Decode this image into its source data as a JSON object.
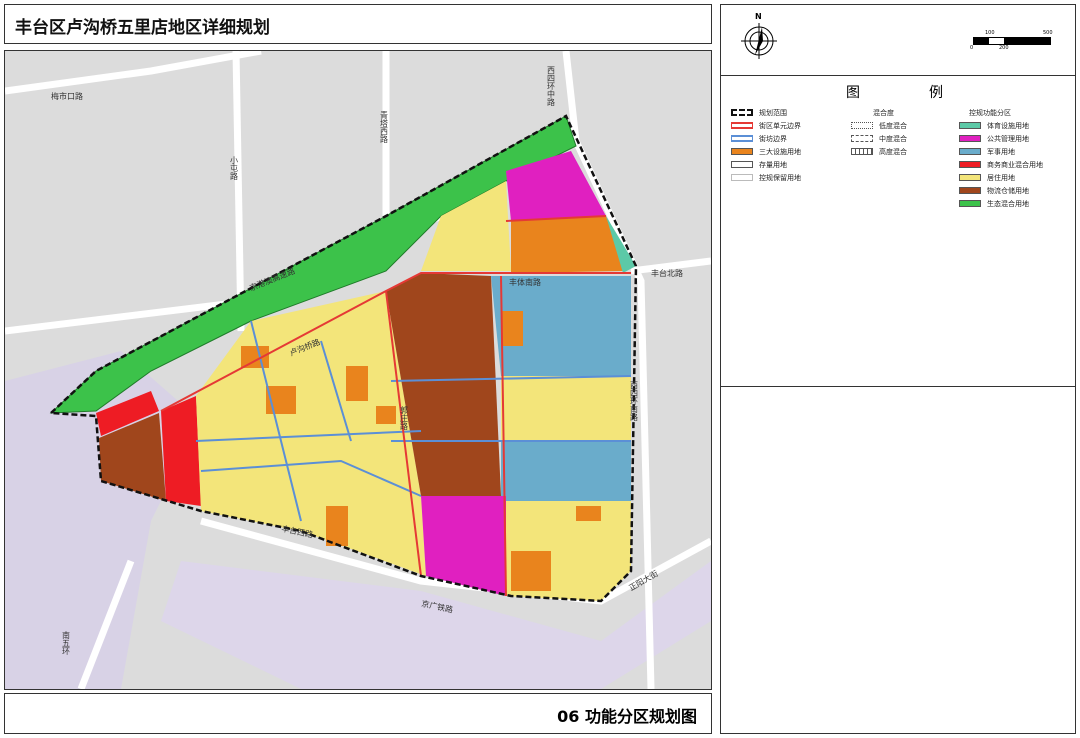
{
  "title": "丰台区卢沟桥五里店地区详细规划",
  "footer": "06 功能分区规划图",
  "compass": {
    "north": "N"
  },
  "scale": {
    "labels": [
      "0",
      "100",
      "200",
      "500"
    ]
  },
  "legend": {
    "heading_left": "图",
    "heading_right": "例",
    "col1": [
      {
        "label": "规划范围",
        "style": "boundary"
      },
      {
        "label": "街区单元边界",
        "color": "#e53935"
      },
      {
        "label": "街坊边界",
        "color": "#5b8fd6"
      },
      {
        "label": "三大设施用地",
        "color": "#e9841d"
      },
      {
        "label": "存量用地",
        "color": "#ffffff"
      },
      {
        "label": "控规保留用地",
        "color": "#ffffff"
      }
    ],
    "col2_title": "混合度",
    "col2": [
      {
        "label": "低度混合"
      },
      {
        "label": "中度混合"
      },
      {
        "label": "高度混合"
      }
    ],
    "col3_title": "控规功能分区",
    "col3": [
      {
        "label": "体育设施用地",
        "color": "#5cc9a7"
      },
      {
        "label": "公共管理用地",
        "color": "#e020c0"
      },
      {
        "label": "军事用地",
        "color": "#6aaccb"
      },
      {
        "label": "商务商业混合用地",
        "color": "#ee1c24"
      },
      {
        "label": "居住用地",
        "color": "#f3e57a"
      },
      {
        "label": "物流仓储用地",
        "color": "#a0461c"
      },
      {
        "label": "生态混合用地",
        "color": "#3cc24a"
      }
    ]
  },
  "roads": [
    "梅市口路",
    "西四环中路",
    "青塔西路",
    "小屯路",
    "京港澳高速路",
    "卢沟桥路",
    "丰体南路",
    "丰台北路",
    "西四环南路",
    "郭庄路",
    "丰台西路",
    "正阳大街",
    "京广铁路",
    "南五环"
  ]
}
